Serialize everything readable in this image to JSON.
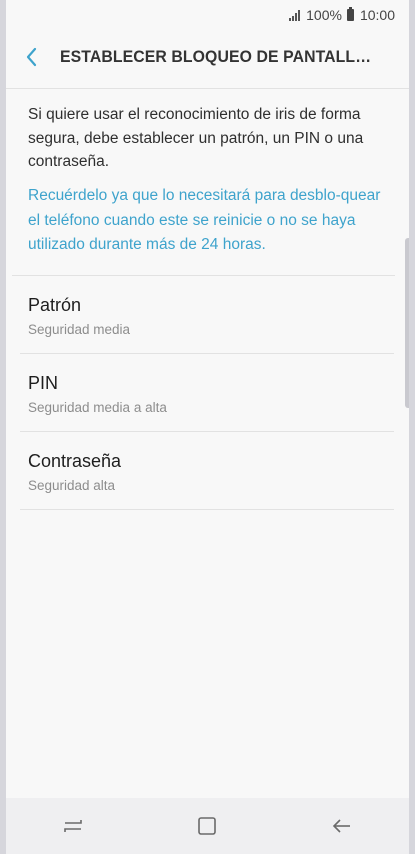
{
  "status_bar": {
    "battery_percent": "100%",
    "time": "10:00"
  },
  "header": {
    "back_icon": "chevron-left-icon",
    "title": "ESTABLECER BLOQUEO DE PANTALLA SEG..."
  },
  "intro_text": "Si quiere usar el reconocimiento de iris de forma segura, debe establecer un patrón, un PIN o una contraseña.",
  "note_text": "Recuérdelo ya que lo necesitará para desblo-quear el teléfono cuando este se reinicie o no se haya utilizado durante más de 24 horas.",
  "options": [
    {
      "title": "Patrón",
      "subtitle": "Seguridad media"
    },
    {
      "title": "PIN",
      "subtitle": "Seguridad media a alta"
    },
    {
      "title": "Contraseña",
      "subtitle": "Seguridad alta"
    }
  ],
  "nav_bar": {
    "icons": [
      "recent-apps-icon",
      "home-icon",
      "back-arrow-icon"
    ]
  },
  "colors": {
    "accent": "#3ea3cc",
    "background": "#f8f8f8",
    "nav_bar": "#efeff1"
  }
}
